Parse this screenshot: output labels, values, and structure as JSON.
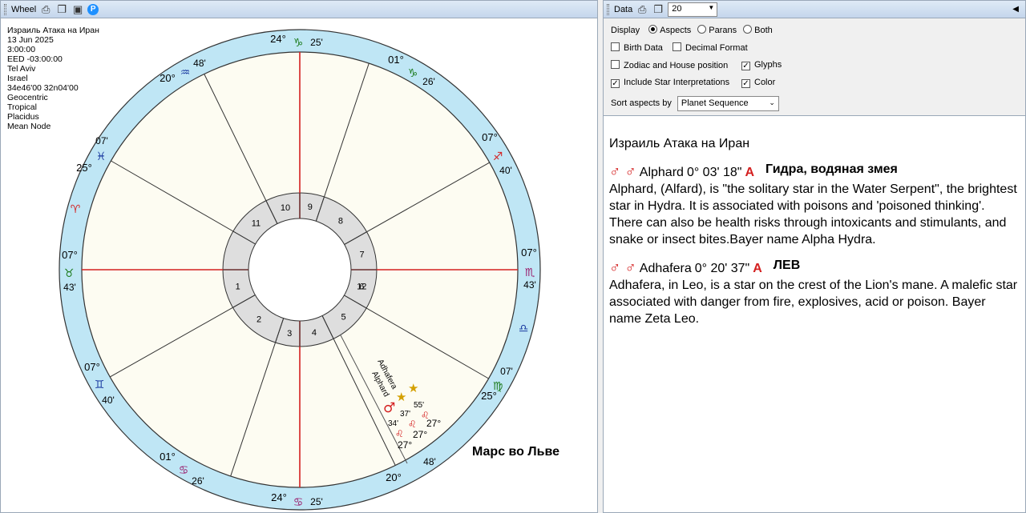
{
  "wheel_pane": {
    "title": "Wheel",
    "chart_info": [
      "Израиль Атака на Иран",
      "13 Jun 2025",
      "3:00:00",
      "EED -03:00:00",
      "Tel Aviv",
      "Israel",
      "34e46'00 32n04'00",
      "Geocentric",
      "Tropical",
      "Placidus",
      "Mean Node"
    ],
    "caption": "Марс во Льве",
    "houses": [
      "1",
      "2",
      "3",
      "4",
      "5",
      "6",
      "7",
      "8",
      "9",
      "10",
      "11",
      "12"
    ],
    "cusps": [
      {
        "deg": "07°",
        "sign": "♉",
        "min": "43'",
        "color": "#1a7a1a"
      },
      {
        "deg": "07°",
        "sign": "♊",
        "min": "40'",
        "color": "#1a3aa0"
      },
      {
        "deg": "01°",
        "sign": "♋",
        "min": "26'",
        "color": "#9a1a6a"
      },
      {
        "deg": "24°",
        "sign": "♋",
        "min": "25'",
        "color": "#9a1a6a"
      },
      {
        "deg": "20°",
        "sign": "",
        "min": "48'",
        "color": "#d42020"
      },
      {
        "deg": "25°",
        "sign": "♍",
        "min": "07'",
        "color": "#1a7a1a"
      },
      {
        "deg": "07°",
        "sign": "♏",
        "min": "43'",
        "color": "#9a1a6a"
      },
      {
        "deg": "07°",
        "sign": "♐",
        "min": "40'",
        "color": "#d42020"
      },
      {
        "deg": "01°",
        "sign": "♑",
        "min": "26'",
        "color": "#1a7a1a"
      },
      {
        "deg": "24°",
        "sign": "♑",
        "min": "25'",
        "color": "#1a7a1a"
      },
      {
        "deg": "20°",
        "sign": "♒",
        "min": "48'",
        "color": "#1a3aa0"
      },
      {
        "deg": "25°",
        "sign": "♓",
        "min": "07'",
        "color": "#1a3aa0"
      }
    ],
    "outer_signs": {
      "aries": "♈",
      "libra": "♎",
      "leo": "♌"
    },
    "points": {
      "adhafera": "Adhafera",
      "alphard": "Alphard",
      "mars_glyph": "♂",
      "star_glyph": "★",
      "p1": "55'",
      "p2": "37'",
      "p3": "34'",
      "p4": "27°",
      "p5": "27°",
      "p6": "27°",
      "leo": "♌"
    }
  },
  "data_pane": {
    "title": "Data",
    "count_value": "20",
    "display_label": "Display",
    "display_options": [
      "Aspects",
      "Parans",
      "Both"
    ],
    "display_selected": "Aspects",
    "checkboxes": [
      {
        "label": "Birth Data",
        "checked": false
      },
      {
        "label": "Decimal Format",
        "checked": false
      },
      {
        "label": "Zodiac and House position",
        "checked": false
      },
      {
        "label": "Glyphs",
        "checked": true
      },
      {
        "label": "Include Star Interpretations",
        "checked": true
      },
      {
        "label": "Color",
        "checked": true
      }
    ],
    "sort_label": "Sort aspects by",
    "sort_value": "Planet Sequence",
    "heading": "Израиль Атака на Иран",
    "stars": [
      {
        "glyphs": "♂ ♂",
        "name": "Alphard",
        "pos": "0° 03' 18\"",
        "aspect": "A",
        "note": "Гидра, водяная змея",
        "text": "Alphard, (Alfard), is \"the solitary star in the Water Serpent\", the brightest star in Hydra. It is associated with poisons and 'poisoned thinking'. There can also be health risks through intoxicants and stimulants, and snake or insect bites.Bayer name Alpha Hydra."
      },
      {
        "glyphs": "♂ ♂",
        "name": "Adhafera",
        "pos": "0° 20' 37\"",
        "aspect": "A",
        "note": "ЛЕВ",
        "text": "Adhafera, in Leo, is a star on the crest of the Lion's mane. A malefic star associated with danger from fire, explosives, acid or poison. Bayer name Zeta Leo."
      }
    ]
  }
}
